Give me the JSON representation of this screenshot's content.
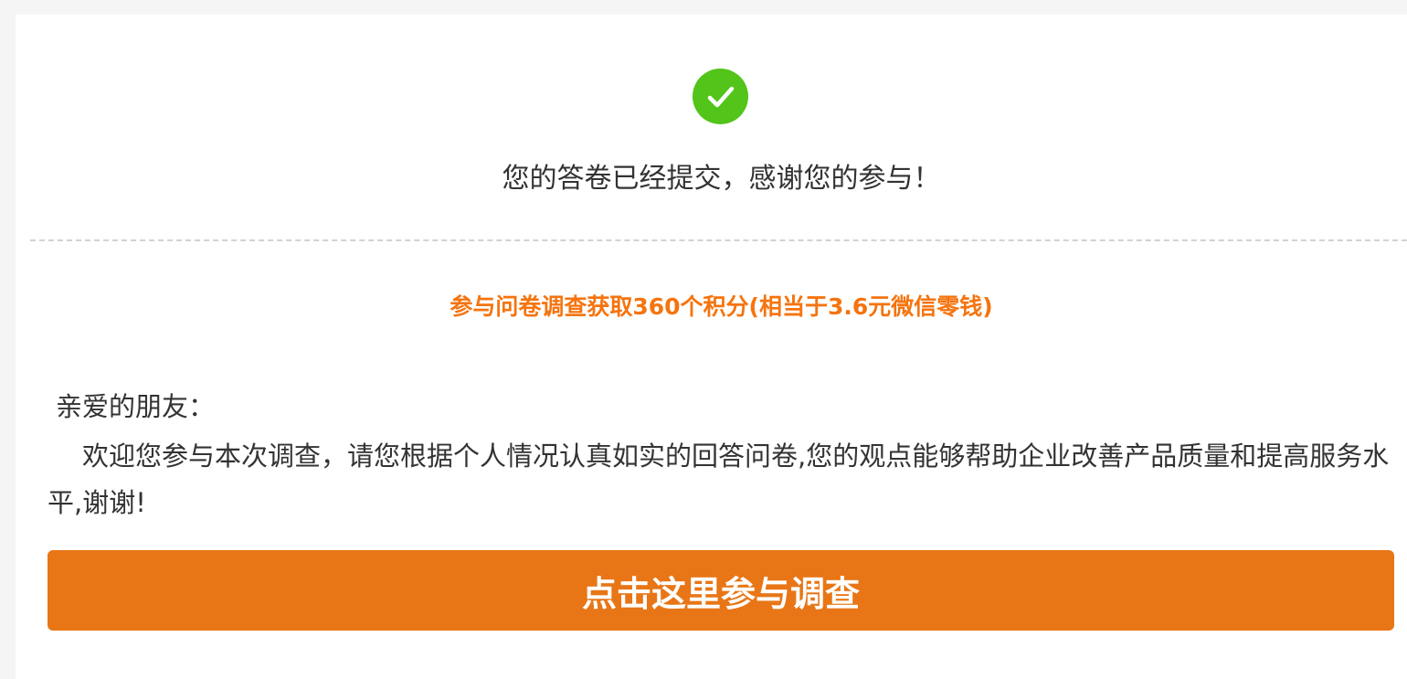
{
  "success": {
    "icon": "check-circle-icon",
    "message": "您的答卷已经提交，感谢您的参与！"
  },
  "reward": {
    "text": "参与问卷调查获取360个积分(相当于3.6元微信零钱)"
  },
  "invitation": {
    "greeting": "亲爱的朋友：",
    "body": "欢迎您参与本次调查，请您根据个人情况认真如实的回答问卷,您的观点能够帮助企业改善产品质量和提高服务水平,谢谢!"
  },
  "cta": {
    "label": "点击这里参与调查"
  },
  "colors": {
    "success_green": "#52c41a",
    "reward_orange": "#f5740f",
    "button_orange": "#e87616",
    "text": "#333333"
  }
}
